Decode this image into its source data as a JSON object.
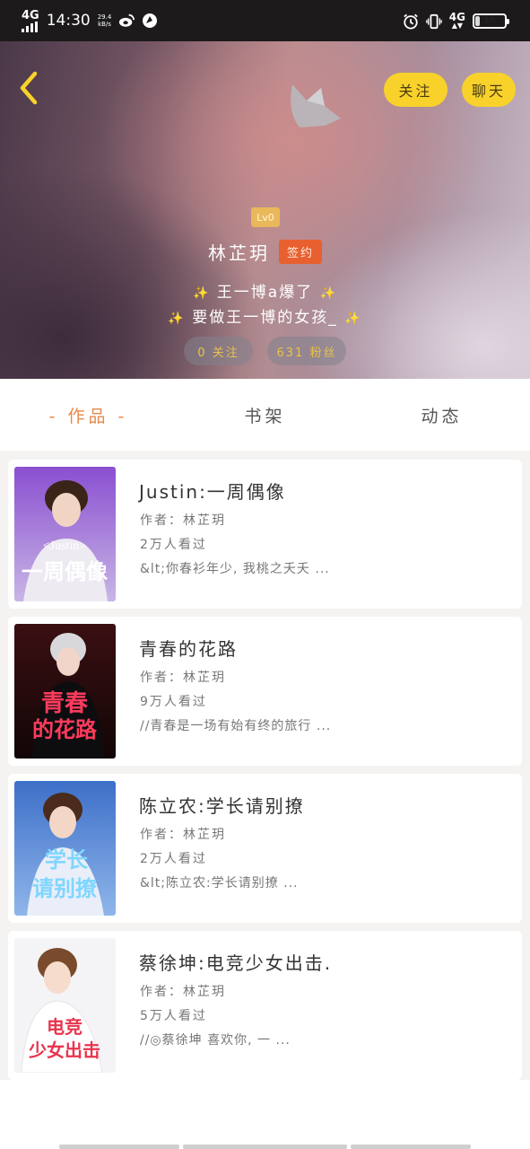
{
  "status_bar": {
    "network": "4G",
    "time": "14:30",
    "speed_value": "29.4",
    "speed_unit": "kB/s",
    "network_right": "4G",
    "battery": "15",
    "icons": [
      "weibo-icon",
      "browser-icon",
      "alarm-icon",
      "vibrate-icon"
    ]
  },
  "header": {
    "back_icon": "chevron-left-icon",
    "follow_label": "关注",
    "chat_label": "聊天",
    "level": "Lv0",
    "name": "林芷玥",
    "contract_badge": "签约",
    "bio_line1": "王一博a爆了",
    "bio_line2": "要做王一博的女孩_",
    "following_stat": "0 关注",
    "fans_stat": "631 粉丝"
  },
  "tabs": [
    {
      "label": "- 作品 -",
      "active": true
    },
    {
      "label": "书架",
      "active": false
    },
    {
      "label": "动态",
      "active": false
    }
  ],
  "works": [
    {
      "title": "Justin:一周偶像",
      "author": "作者：林芷玥",
      "views": "2万人看过",
      "desc": "&lt;你春衫年少, 我桃之夭夭 ...",
      "cover_text1": "<Justin>",
      "cover_text2": "一周偶像"
    },
    {
      "title": "青春的花路",
      "author": "作者：林芷玥",
      "views": "9万人看过",
      "desc": "//青春是一场有始有终的旅行 ...",
      "cover_text1": "青春",
      "cover_text2": "的花路"
    },
    {
      "title": "陈立农:学长请别撩",
      "author": "作者：林芷玥",
      "views": "2万人看过",
      "desc": "&lt;陈立农:学长请别撩 ...",
      "cover_text1": "学长",
      "cover_text2": "请别撩"
    },
    {
      "title": "蔡徐坤:电竞少女出击.",
      "author": "作者：林芷玥",
      "views": "5万人看过",
      "desc": "//◎蔡徐坤      喜欢你, 一 ...",
      "cover_text1": "电竞",
      "cover_text2": "少女出击"
    }
  ],
  "colors": {
    "accent_yellow": "#f8d22b",
    "active_tab": "#e8874a",
    "contract_badge": "#e8602f",
    "level_badge": "#e9b85a"
  }
}
